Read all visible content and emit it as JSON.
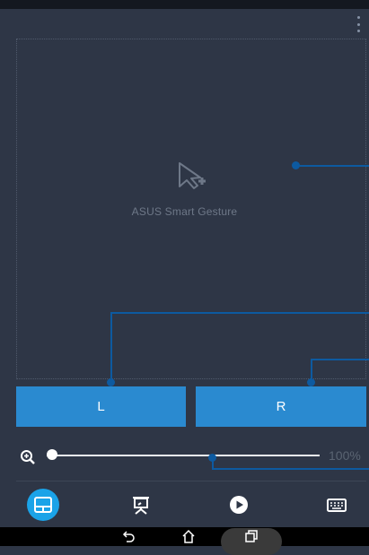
{
  "touchpad": {
    "label": "ASUS Smart Gesture"
  },
  "buttons": {
    "left": "L",
    "right": "R"
  },
  "zoom": {
    "value_text": "100%",
    "level": 0.02
  },
  "modes": [
    {
      "name": "touchpad",
      "icon": "touchpad-icon",
      "active": true
    },
    {
      "name": "presentation",
      "icon": "presentation-icon",
      "active": false
    },
    {
      "name": "media",
      "icon": "play-icon",
      "active": false
    },
    {
      "name": "keyboard",
      "icon": "keyboard-icon",
      "active": false
    }
  ],
  "navigation": {
    "icons": [
      "back-icon",
      "home-icon",
      "recents-icon"
    ]
  },
  "colors": {
    "accent": "#1aa3e8",
    "button": "#2a8ad0",
    "callout": "#0d5aa0",
    "background": "#2e3646"
  }
}
